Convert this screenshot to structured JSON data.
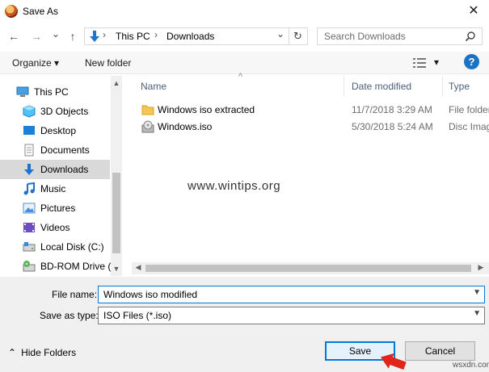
{
  "window": {
    "title": "Save As",
    "close_glyph": "✕"
  },
  "nav": {
    "back_glyph": "←",
    "forward_glyph": "→",
    "recent_glyph": "⌄",
    "up_glyph": "↑",
    "address": {
      "segments": [
        "This PC",
        "Downloads"
      ],
      "separator": "›",
      "dropdown_glyph": "⌄",
      "refresh_glyph": "↻"
    },
    "search": {
      "placeholder": "Search Downloads",
      "icon": "search-icon"
    }
  },
  "toolbar": {
    "organize": "Organize ▾",
    "new_folder": "New folder",
    "view_dropdown": "▾",
    "help": "?"
  },
  "sidebar": {
    "items": [
      {
        "label": "This PC",
        "icon": "pc-icon"
      },
      {
        "label": "3D Objects",
        "icon": "cube-icon"
      },
      {
        "label": "Desktop",
        "icon": "desktop-icon"
      },
      {
        "label": "Documents",
        "icon": "document-icon"
      },
      {
        "label": "Downloads",
        "icon": "download-icon",
        "selected": true
      },
      {
        "label": "Music",
        "icon": "music-icon"
      },
      {
        "label": "Pictures",
        "icon": "picture-icon"
      },
      {
        "label": "Videos",
        "icon": "video-icon"
      },
      {
        "label": "Local Disk (C:)",
        "icon": "disk-icon"
      },
      {
        "label": "BD-ROM Drive (I",
        "icon": "bdrom-icon"
      }
    ]
  },
  "file_list": {
    "columns": [
      "Name",
      "Date modified",
      "Type"
    ],
    "sort_glyph": "^",
    "rows": [
      {
        "name": "Windows iso extracted",
        "date": "11/7/2018 3:29 AM",
        "type": "File folder",
        "icon": "folder-icon"
      },
      {
        "name": "Windows.iso",
        "date": "5/30/2018 5:24 AM",
        "type": "Disc Image",
        "icon": "disc-image-icon"
      }
    ]
  },
  "bottom": {
    "file_name_label": "File name:",
    "file_name_value": "Windows iso modified",
    "save_type_label": "Save as type:",
    "save_type_value": "ISO Files (*.iso)",
    "hide_folders": "Hide Folders",
    "hide_glyph": "⌃",
    "save_label": "Save",
    "cancel_label": "Cancel"
  },
  "watermarks": {
    "center": "www.wintips.org",
    "corner": "wsxdn.com"
  }
}
